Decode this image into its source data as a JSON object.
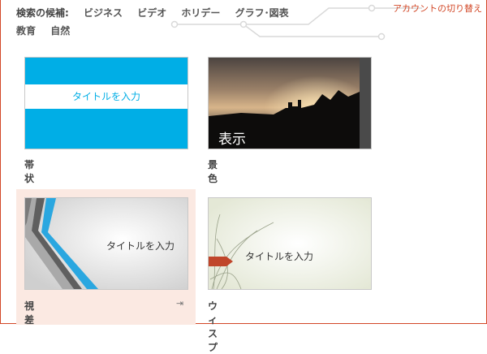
{
  "account": {
    "switch_label": "アカウントの切り替え"
  },
  "search": {
    "label": "検索の候補:",
    "categories": [
      "ビジネス",
      "ビデオ",
      "ホリデー",
      "グラフ･図表",
      "教育",
      "自然"
    ]
  },
  "templates": [
    {
      "name": "帯状",
      "thumb_text": "タイトルを入力"
    },
    {
      "name": "景色",
      "thumb_text": "表示"
    },
    {
      "name": "視差",
      "thumb_text": "タイトルを入力",
      "pin_icon": "pin-icon"
    },
    {
      "name": "ウィスプ",
      "thumb_text": "タイトルを入力"
    }
  ],
  "colors": {
    "accent": "#d24726",
    "banded_blue": "#00aee6",
    "selected_bg": "#fbe9e2"
  }
}
